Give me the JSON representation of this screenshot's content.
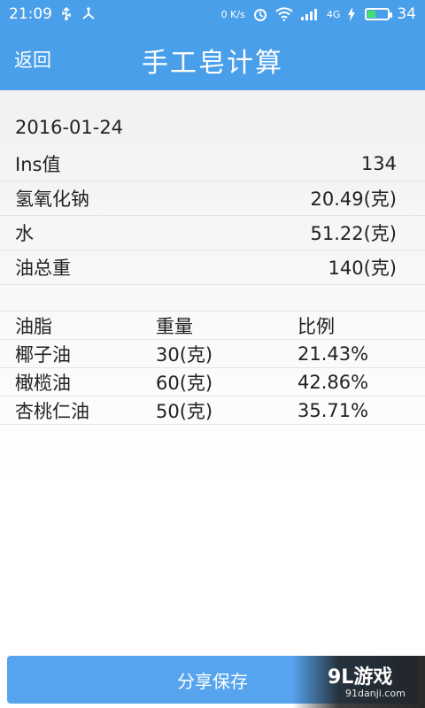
{
  "status_bar": {
    "time": "21:09",
    "network_speed": "0 K/s",
    "network_type": "4G",
    "battery": "34"
  },
  "header": {
    "back_label": "返回",
    "title": "手工皂计算"
  },
  "record": {
    "date": "2016-01-24",
    "rows": [
      {
        "label": "Ins值",
        "value": "134"
      },
      {
        "label": "氢氧化钠",
        "value": "20.49(克)"
      },
      {
        "label": "水",
        "value": "51.22(克)"
      },
      {
        "label": "油总重",
        "value": "140(克)"
      }
    ]
  },
  "oils": {
    "headers": [
      "油脂",
      "重量",
      "比例"
    ],
    "rows": [
      [
        "椰子油",
        "30(克)",
        "21.43%"
      ],
      [
        "橄榄油",
        "60(克)",
        "42.86%"
      ],
      [
        "杏桃仁油",
        "50(克)",
        "35.71%"
      ]
    ]
  },
  "footer": {
    "share_label": "分享保存"
  },
  "watermark": {
    "brand": "9L游戏",
    "url": "91danji.com"
  },
  "colors": {
    "accent": "#4a9fea",
    "button": "#56a4ee"
  }
}
